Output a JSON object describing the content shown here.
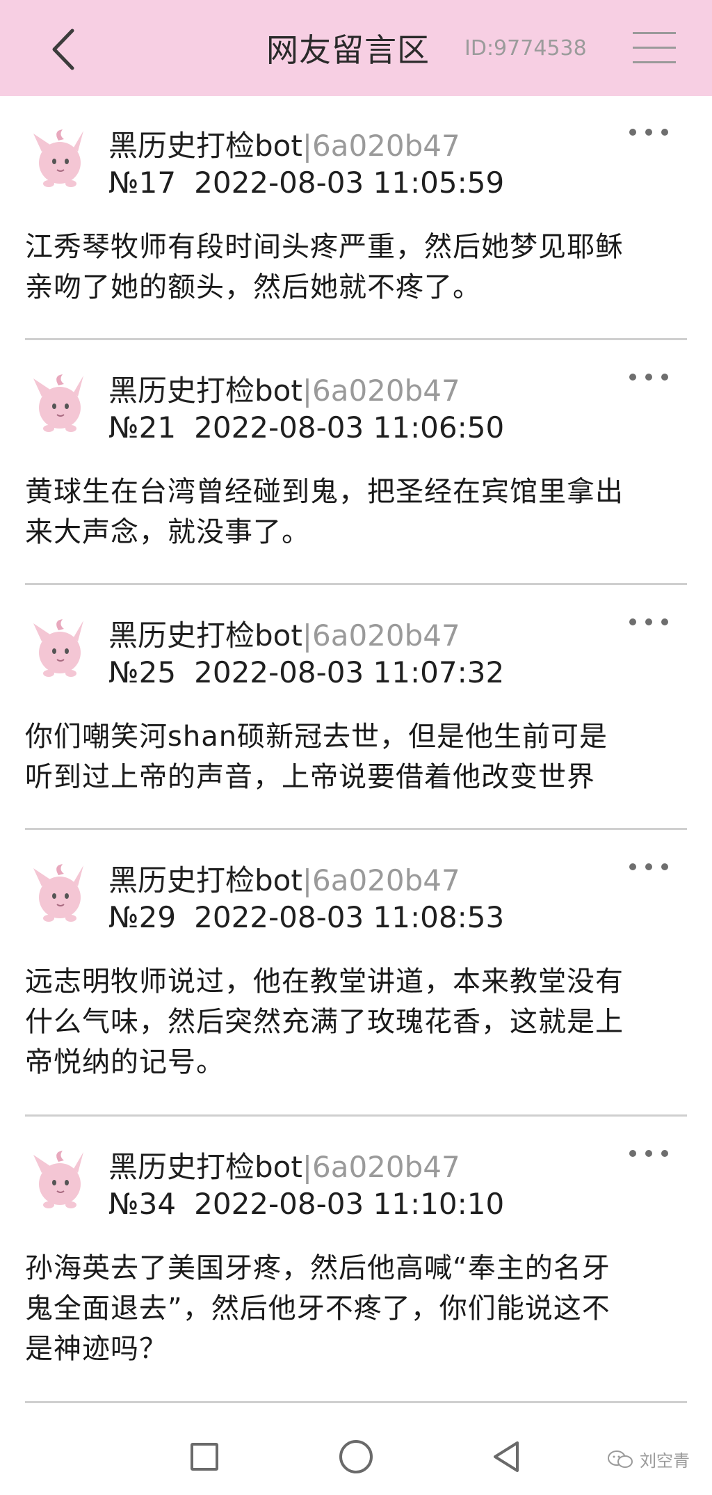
{
  "header": {
    "title": "网友留言区",
    "id_text": "ID:9774538"
  },
  "comments": [
    {
      "user_name": "黑历史打检bot",
      "user_hash": "|6a020b47",
      "floor": "№17",
      "timestamp": "2022-08-03 11:05:59",
      "lines": [
        "江秀琴牧师有段时间头疼严重，然后她梦见耶稣",
        "亲吻了她的额头，然后她就不疼了。"
      ]
    },
    {
      "user_name": "黑历史打检bot",
      "user_hash": "|6a020b47",
      "floor": "№21",
      "timestamp": "2022-08-03 11:06:50",
      "lines": [
        "黄球生在台湾曾经碰到鬼，把圣经在宾馆里拿出",
        "来大声念，就没事了。"
      ]
    },
    {
      "user_name": "黑历史打检bot",
      "user_hash": "|6a020b47",
      "floor": "№25",
      "timestamp": "2022-08-03 11:07:32",
      "lines": [
        "你们嘲笑河shan硕新冠去世，但是他生前可是",
        "听到过上帝的声音，上帝说要借着他改变世界"
      ]
    },
    {
      "user_name": "黑历史打检bot",
      "user_hash": "|6a020b47",
      "floor": "№29",
      "timestamp": "2022-08-03 11:08:53",
      "lines": [
        "远志明牧师说过，他在教堂讲道，本来教堂没有",
        "什么气味，然后突然充满了玫瑰花香，这就是上",
        "帝悦纳的记号。"
      ]
    },
    {
      "user_name": "黑历史打检bot",
      "user_hash": "|6a020b47",
      "floor": "№34",
      "timestamp": "2022-08-03 11:10:10",
      "lines": [
        "孙海英去了美国牙疼，然后他高喊“奉主的名牙",
        "鬼全面退去”，然后他牙不疼了，你们能说这不",
        "是神迹吗？"
      ]
    }
  ],
  "watermark": {
    "text": "刘空青"
  },
  "colors": {
    "header_bg": "#f7cfe3",
    "avatar_pink": "#f4c6d4",
    "divider": "#cfcfcf",
    "user_hash": "#9a9a9a"
  },
  "icons": {
    "back": "chevron-left-icon",
    "menu": "hamburger-icon",
    "more": "more-dots-icon",
    "avatar": "clefairy-avatar-icon",
    "nav_recent": "square-icon",
    "nav_home": "circle-icon",
    "nav_back": "triangle-back-icon"
  }
}
